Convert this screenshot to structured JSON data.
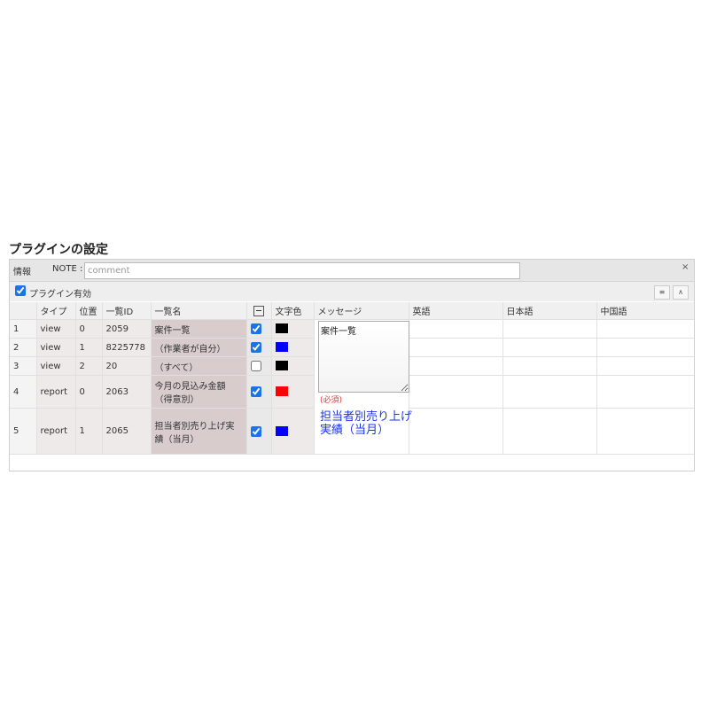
{
  "page": {
    "title": "プラグインの設定"
  },
  "info_bar": {
    "info_label": "情報",
    "note_label": "NOTE :",
    "note_placeholder": "comment",
    "close_glyph": "×"
  },
  "enable": {
    "label": "プラグイン有効",
    "checked": true
  },
  "toolbar": {
    "collapse_glyph": "≡",
    "expand_glyph": "∧"
  },
  "table": {
    "headers": {
      "type": "タイプ",
      "position": "位置",
      "list_id": "一覧ID",
      "list_name": "一覧名",
      "color": "文字色",
      "message": "メッセージ",
      "english": "英語",
      "japanese": "日本語",
      "chinese": "中国語"
    },
    "rows": [
      {
        "num": "1",
        "type": "view",
        "pos": "0",
        "id": "2059",
        "name": "案件一覧",
        "checked": true,
        "color": "#000000"
      },
      {
        "num": "2",
        "type": "view",
        "pos": "1",
        "id": "8225778",
        "name": "（作業者が自分）",
        "checked": true,
        "color": "#0000ff"
      },
      {
        "num": "3",
        "type": "view",
        "pos": "2",
        "id": "20",
        "name": "（すべて）",
        "checked": false,
        "color": "#000000"
      },
      {
        "num": "4",
        "type": "report",
        "pos": "0",
        "id": "2063",
        "name": "今月の見込み金額（得意別）",
        "checked": true,
        "color": "#ff0000"
      },
      {
        "num": "5",
        "type": "report",
        "pos": "1",
        "id": "2065",
        "name": "担当者別売り上げ実績（当月）",
        "checked": true,
        "color": "#0000ff"
      }
    ]
  },
  "message": {
    "textarea_value": "案件一覧",
    "error_text": "(必須)",
    "preview_text": "担当者別売り上げ実績（当月）"
  }
}
